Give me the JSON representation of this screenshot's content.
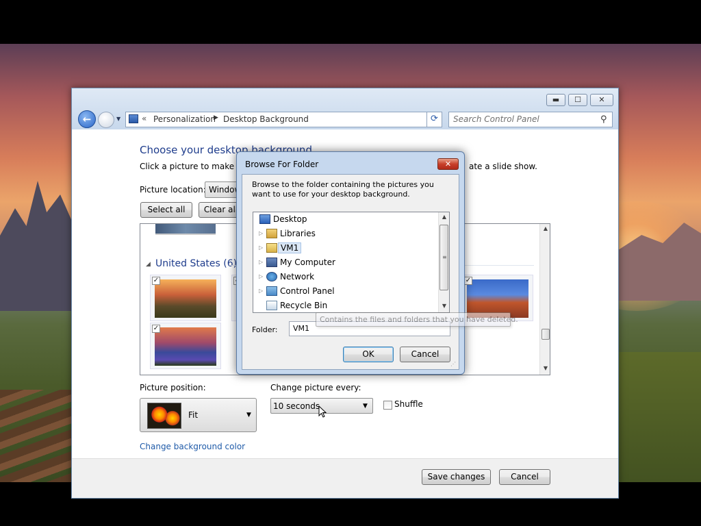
{
  "window": {
    "minimize_icon": "minimize-icon",
    "maximize_icon": "maximize-icon",
    "close_icon": "close-icon",
    "minimize_glyph": "▬",
    "maximize_glyph": "☐",
    "close_glyph": "✕"
  },
  "nav": {
    "back_glyph": "←",
    "recent_glyph": "▼",
    "breadcrumb_dbl": "«",
    "breadcrumb": [
      "Personalization",
      "Desktop Background"
    ],
    "separator": "▶",
    "dropdown_glyph": "▼",
    "refresh_glyph": "⟳"
  },
  "search": {
    "placeholder": "Search Control Panel",
    "icon_glyph": "⚲"
  },
  "page": {
    "title": "Choose your desktop background",
    "description": "Click a picture to make it y",
    "description_tail": "ate a slide show.",
    "picture_location_label": "Picture location:",
    "picture_location_value": "Window",
    "select_all": "Select all",
    "clear_all": "Clear all"
  },
  "gallery": {
    "group_title": "United States (6)",
    "group_toggle_glyph": "◢",
    "check_glyph": "✓",
    "scroll_up_glyph": "▲",
    "scroll_down_glyph": "▼"
  },
  "position": {
    "label": "Picture position:",
    "value": "Fit",
    "arrow": "▼"
  },
  "slideshow": {
    "label": "Change picture every:",
    "interval": "10 seconds",
    "arrow": "▼",
    "shuffle_label": "Shuffle",
    "shuffle_checked": false
  },
  "change_color_link": "Change background color",
  "footer": {
    "save": "Save changes",
    "cancel": "Cancel"
  },
  "dialog": {
    "title": "Browse For Folder",
    "close_glyph": "✕",
    "description": "Browse to the folder containing the pictures you want to use for your desktop background.",
    "tree": [
      {
        "label": "Desktop",
        "icon": "desktop-icon",
        "expander": ""
      },
      {
        "label": "Libraries",
        "icon": "libraries-icon",
        "expander": "▷"
      },
      {
        "label": "VM1",
        "icon": "user-folder-icon",
        "expander": "▷",
        "selected": true
      },
      {
        "label": "My Computer",
        "icon": "computer-icon",
        "expander": "▷"
      },
      {
        "label": "Network",
        "icon": "network-icon",
        "expander": "▷"
      },
      {
        "label": "Control Panel",
        "icon": "control-panel-icon",
        "expander": "▷"
      },
      {
        "label": "Recycle Bin",
        "icon": "recycle-bin-icon",
        "expander": ""
      }
    ],
    "scroll_up_glyph": "▲",
    "scroll_down_glyph": "▼",
    "scroll_grip_glyph": "≡",
    "folder_label": "Folder:",
    "folder_value": "VM1",
    "ok": "OK",
    "cancel": "Cancel",
    "resize_grip": "⋰"
  },
  "tooltip": "Contains the files and folders that you have deleted."
}
